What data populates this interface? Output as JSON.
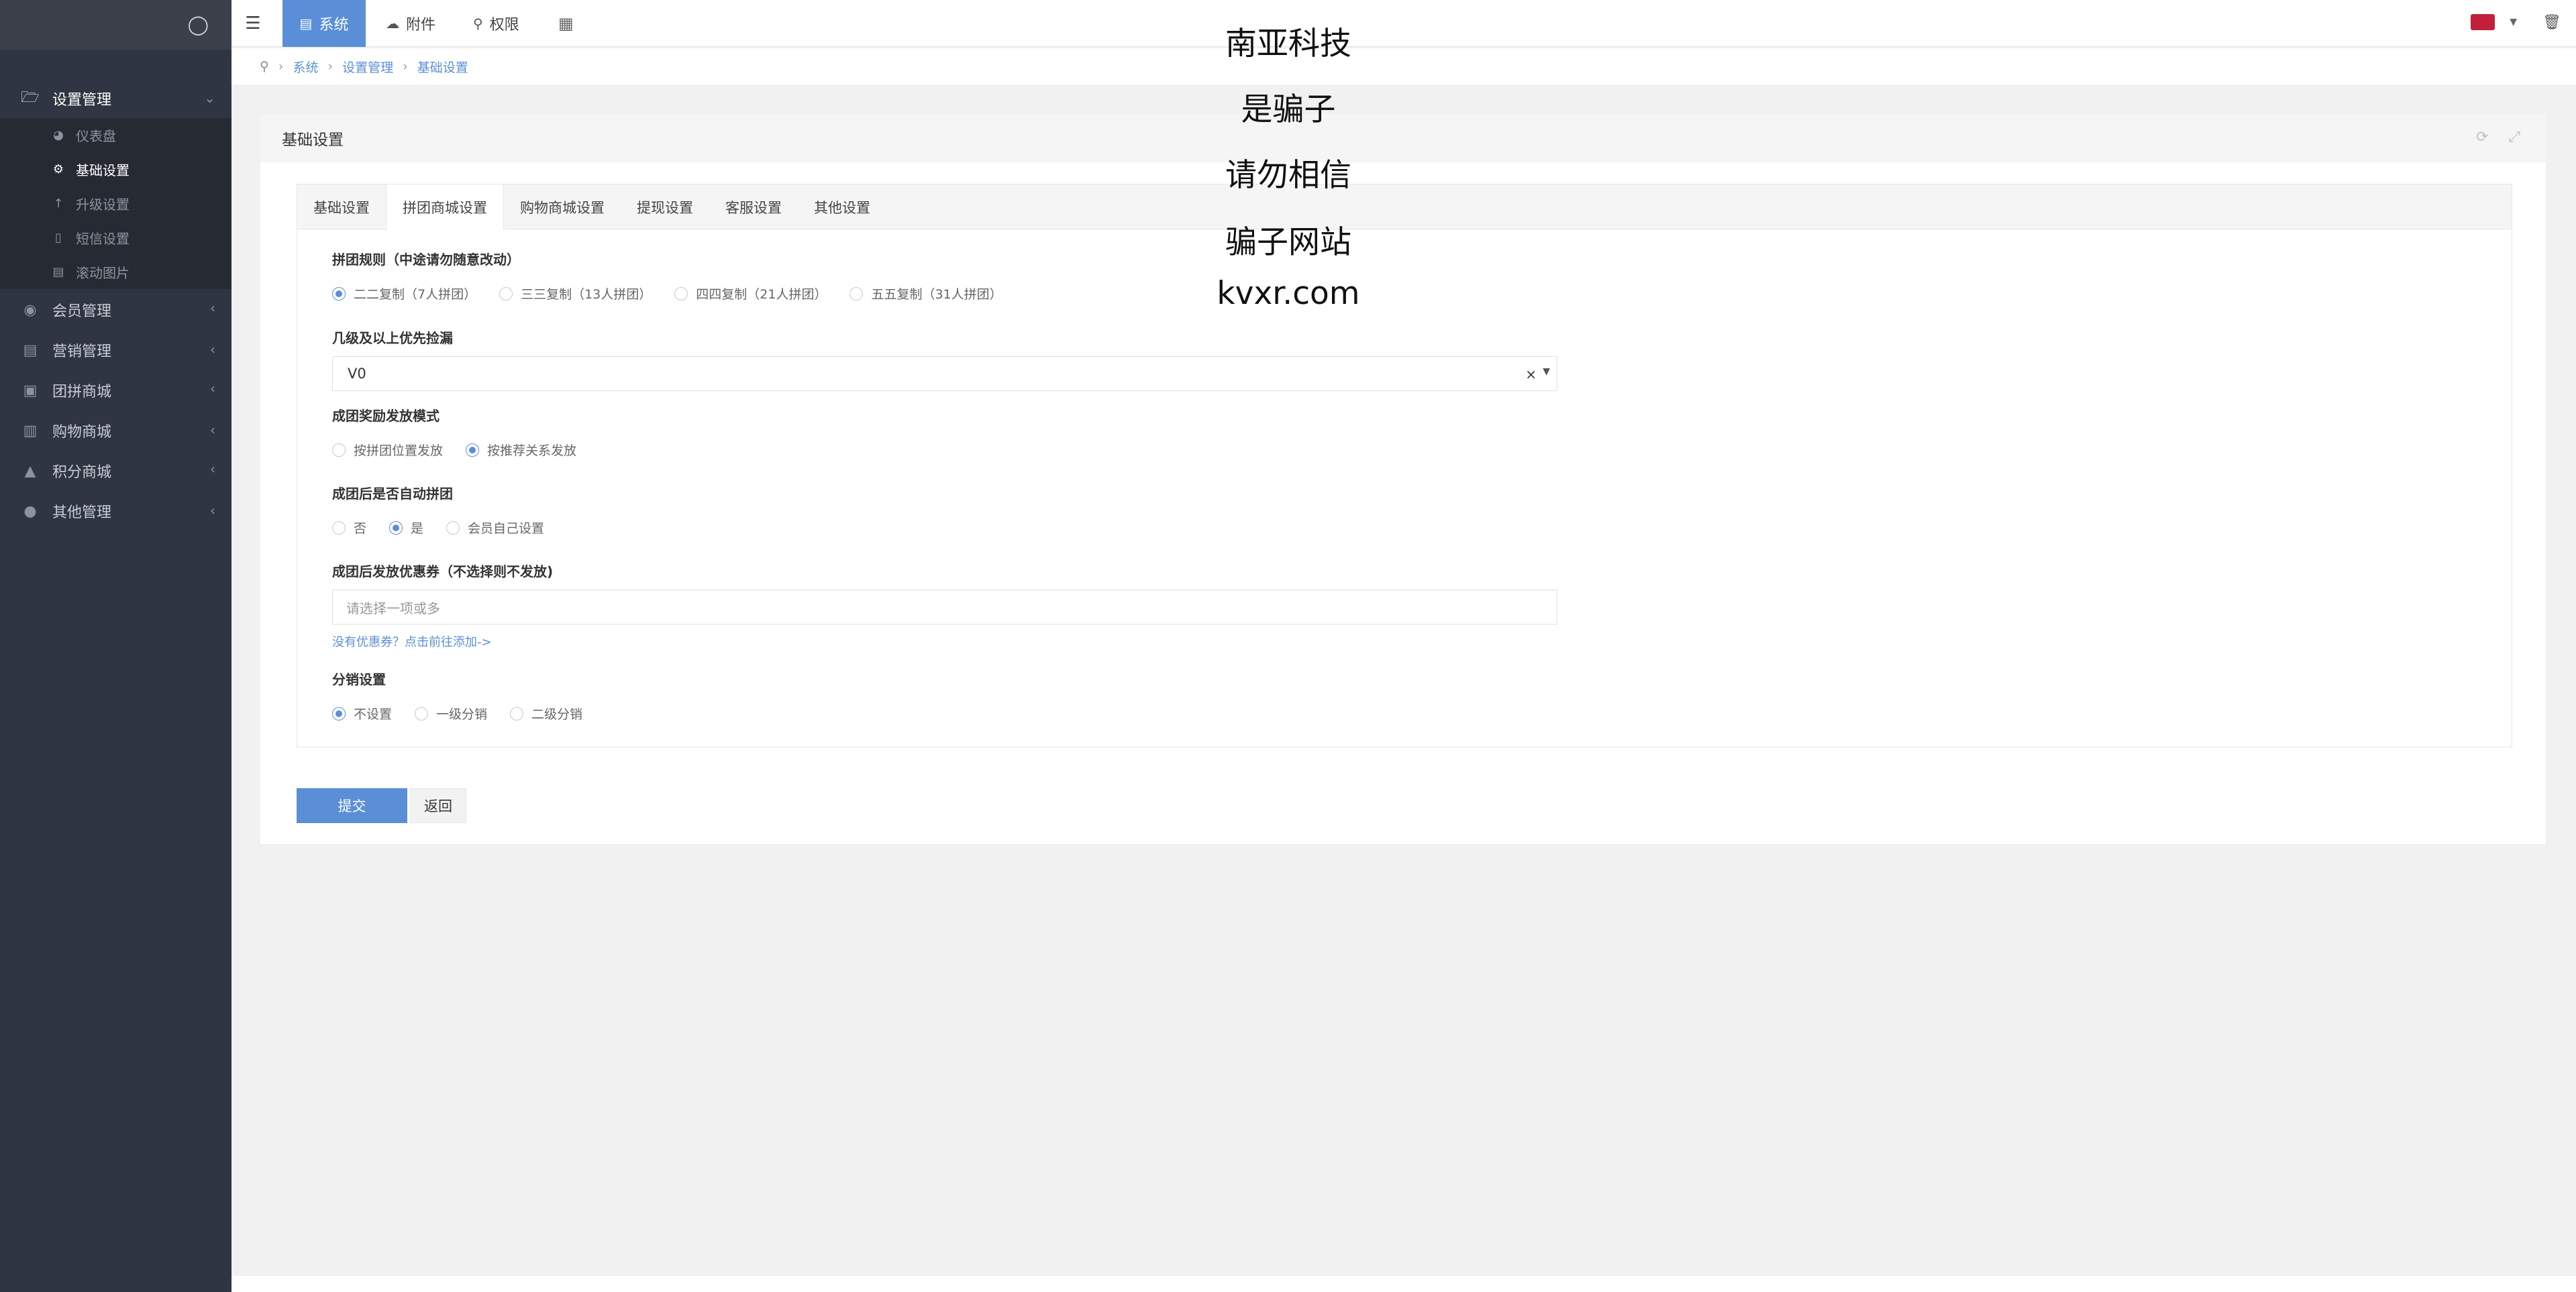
{
  "sidebar": {
    "groups": [
      {
        "label": "设置管理",
        "icon": "folder-open-icon",
        "active": true
      },
      {
        "label": "会员管理",
        "icon": "user-circle-icon"
      },
      {
        "label": "营销管理",
        "icon": "money-icon"
      },
      {
        "label": "团拼商城",
        "icon": "basket-icon"
      },
      {
        "label": "购物商城",
        "icon": "cart-icon"
      },
      {
        "label": "积分商城",
        "icon": "bank-icon"
      },
      {
        "label": "其他管理",
        "icon": "chat-icon"
      }
    ],
    "sub_items": [
      {
        "label": "仪表盘",
        "icon": "dashboard-icon"
      },
      {
        "label": "基础设置",
        "icon": "gear-icon",
        "active": true
      },
      {
        "label": "升级设置",
        "icon": "arrow-up-icon"
      },
      {
        "label": "短信设置",
        "icon": "mobile-icon"
      },
      {
        "label": "滚动图片",
        "icon": "image-icon"
      }
    ]
  },
  "topbar": {
    "items": [
      {
        "label": "系统",
        "icon": "monitor-icon",
        "active": true
      },
      {
        "label": "附件",
        "icon": "cloud-icon"
      },
      {
        "label": "权限",
        "icon": "key-icon"
      }
    ]
  },
  "breadcrumb": [
    "系统",
    "设置管理",
    "基础设置"
  ],
  "panel": {
    "title": "基础设置",
    "tabs": [
      "基础设置",
      "拼团商城设置",
      "购物商城设置",
      "提现设置",
      "客服设置",
      "其他设置"
    ],
    "active_tab": 1,
    "fields": {
      "rule": {
        "label": "拼团规则（中途请勿随意改动）",
        "options": [
          "二二复制（7人拼团）",
          "三三复制（13人拼团）",
          "四四复制（21人拼团）",
          "五五复制（31人拼团）"
        ],
        "selected": 0
      },
      "level": {
        "label": "几级及以上优先捡漏",
        "value": "V0"
      },
      "reward": {
        "label": "成团奖励发放模式",
        "options": [
          "按拼团位置发放",
          "按推荐关系发放"
        ],
        "selected": 1
      },
      "auto": {
        "label": "成团后是否自动拼团",
        "options": [
          "否",
          "是",
          "会员自己设置"
        ],
        "selected": 1
      },
      "coupon": {
        "label": "成团后发放优惠券（不选择则不发放)",
        "placeholder": "请选择一项或多",
        "hint": "没有优惠券？点击前往添加->"
      },
      "dist": {
        "label": "分销设置",
        "options": [
          "不设置",
          "一级分销",
          "二级分销"
        ],
        "selected": 0
      }
    },
    "submit_label": "提交",
    "back_label": "返回"
  },
  "watermark": [
    "南亚科技",
    "是骗子",
    "请勿相信",
    "骗子网站",
    "kvxr.com"
  ],
  "colors": {
    "accent": "#5a8fd8",
    "sidebar": "#2f3542"
  }
}
